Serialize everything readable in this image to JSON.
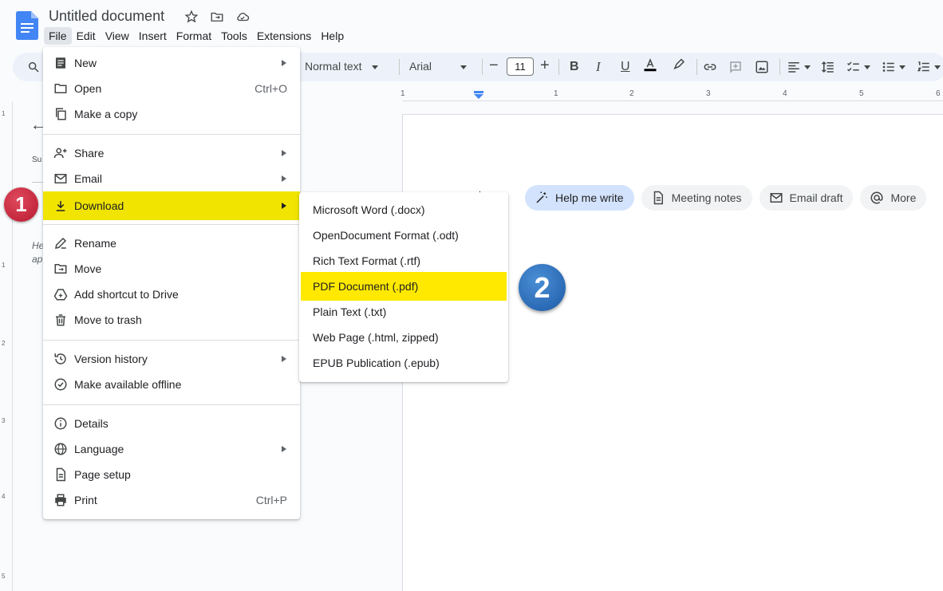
{
  "app": {
    "doc_title": "Untitled document",
    "menubar": [
      "File",
      "Edit",
      "View",
      "Insert",
      "Format",
      "Tools",
      "Extensions",
      "Help"
    ],
    "active_menu": "File"
  },
  "toolbar": {
    "style": "Normal text",
    "font": "Arial",
    "font_size": "11"
  },
  "side": {
    "summary_abbrev": "Su",
    "helper_line1": "He",
    "helper_line2": "ap"
  },
  "ruler": {
    "h_numbers": [
      "1",
      "1",
      "2",
      "3",
      "4",
      "5",
      "6"
    ],
    "v_numbers": [
      "1",
      "1",
      "2",
      "3",
      "4",
      "5"
    ]
  },
  "chips": {
    "help_me_write": "Help me write",
    "meeting_notes": "Meeting notes",
    "email_draft": "Email draft",
    "more": "More"
  },
  "file_menu": {
    "items": [
      {
        "label": "New",
        "icon": "document-icon",
        "submenu": true
      },
      {
        "label": "Open",
        "icon": "folder-icon",
        "shortcut": "Ctrl+O"
      },
      {
        "label": "Make a copy",
        "icon": "copy-icon"
      },
      {
        "label": "Share",
        "icon": "person-add-icon",
        "submenu": true
      },
      {
        "label": "Email",
        "icon": "mail-icon",
        "submenu": true
      },
      {
        "label": "Download",
        "icon": "download-icon",
        "submenu": true,
        "highlighted": true
      },
      {
        "label": "Rename",
        "icon": "pencil-icon"
      },
      {
        "label": "Move",
        "icon": "move-folder-icon"
      },
      {
        "label": "Add shortcut to Drive",
        "icon": "drive-shortcut-icon"
      },
      {
        "label": "Move to trash",
        "icon": "trash-icon"
      },
      {
        "label": "Version history",
        "icon": "history-icon",
        "submenu": true
      },
      {
        "label": "Make available offline",
        "icon": "offline-check-icon"
      },
      {
        "label": "Details",
        "icon": "info-icon"
      },
      {
        "label": "Language",
        "icon": "globe-icon",
        "submenu": true
      },
      {
        "label": "Page setup",
        "icon": "page-icon"
      },
      {
        "label": "Print",
        "icon": "print-icon",
        "shortcut": "Ctrl+P"
      }
    ]
  },
  "download_menu": {
    "items": [
      "Microsoft Word (.docx)",
      "OpenDocument Format (.odt)",
      "Rich Text Format (.rtf)",
      "PDF Document (.pdf)",
      "Plain Text (.txt)",
      "Web Page (.html, zipped)",
      "EPUB Publication (.epub)"
    ],
    "highlighted_index": 3
  },
  "badges": {
    "step1": "1",
    "step2": "2"
  },
  "colors": {
    "highlight_yellow": "#f0e400",
    "badge1": "#c8213a",
    "badge2": "#2e6fbe",
    "docs_blue": "#4285f4"
  }
}
